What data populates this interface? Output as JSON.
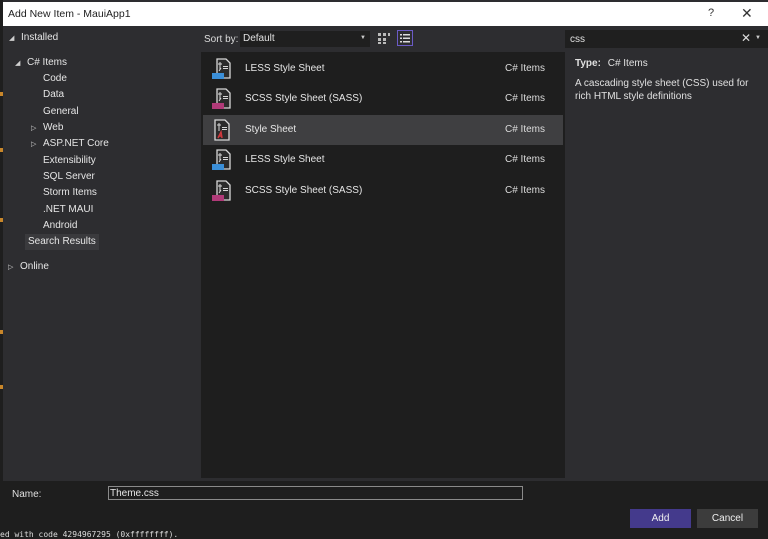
{
  "window": {
    "title": "Add New Item - MauiApp1",
    "help_label": "?",
    "close_label": "✕"
  },
  "tree": {
    "installed": "Installed",
    "csharp_items": "C# Items",
    "children": [
      {
        "label": "Code",
        "expandable": false
      },
      {
        "label": "Data",
        "expandable": false
      },
      {
        "label": "General",
        "expandable": false
      },
      {
        "label": "Web",
        "expandable": true
      },
      {
        "label": "ASP.NET Core",
        "expandable": true
      },
      {
        "label": "Extensibility",
        "expandable": false
      },
      {
        "label": "SQL Server",
        "expandable": false
      },
      {
        "label": "Storm Items",
        "expandable": false
      },
      {
        "label": ".NET MAUI",
        "expandable": false
      },
      {
        "label": "Android",
        "expandable": false
      }
    ],
    "search_results": "Search Results",
    "online": "Online"
  },
  "sortbar": {
    "label": "Sort by:",
    "selected": "Default"
  },
  "search": {
    "value": "css",
    "clear_icon": "✕"
  },
  "items": [
    {
      "name": "LESS Style Sheet",
      "category": "C# Items",
      "badge": "LESS",
      "badge_color": "#3b8fd8",
      "selected": false
    },
    {
      "name": "SCSS Style Sheet (SASS)",
      "category": "C# Items",
      "badge": "SASS",
      "badge_color": "#b03a78",
      "selected": false
    },
    {
      "name": "Style Sheet",
      "category": "C# Items",
      "badge": "",
      "badge_color": "#d0393d",
      "selected": true
    },
    {
      "name": "LESS Style Sheet",
      "category": "C# Items",
      "badge": "LESS",
      "badge_color": "#3b8fd8",
      "selected": false
    },
    {
      "name": "SCSS Style Sheet (SASS)",
      "category": "C# Items",
      "badge": "SASS",
      "badge_color": "#b03a78",
      "selected": false
    }
  ],
  "details": {
    "type_label": "Type:",
    "type_value": "C# Items",
    "description": "A cascading style sheet (CSS) used for rich HTML style definitions"
  },
  "bottom": {
    "name_label": "Name:",
    "name_value": "Theme.css",
    "add_label": "Add",
    "cancel_label": "Cancel"
  },
  "console": {
    "text": "ed with code 4294967295 (0xffffffff)."
  },
  "colors": {
    "accent": "#443a8c",
    "view_toggle_border": "#6b5bc7"
  }
}
